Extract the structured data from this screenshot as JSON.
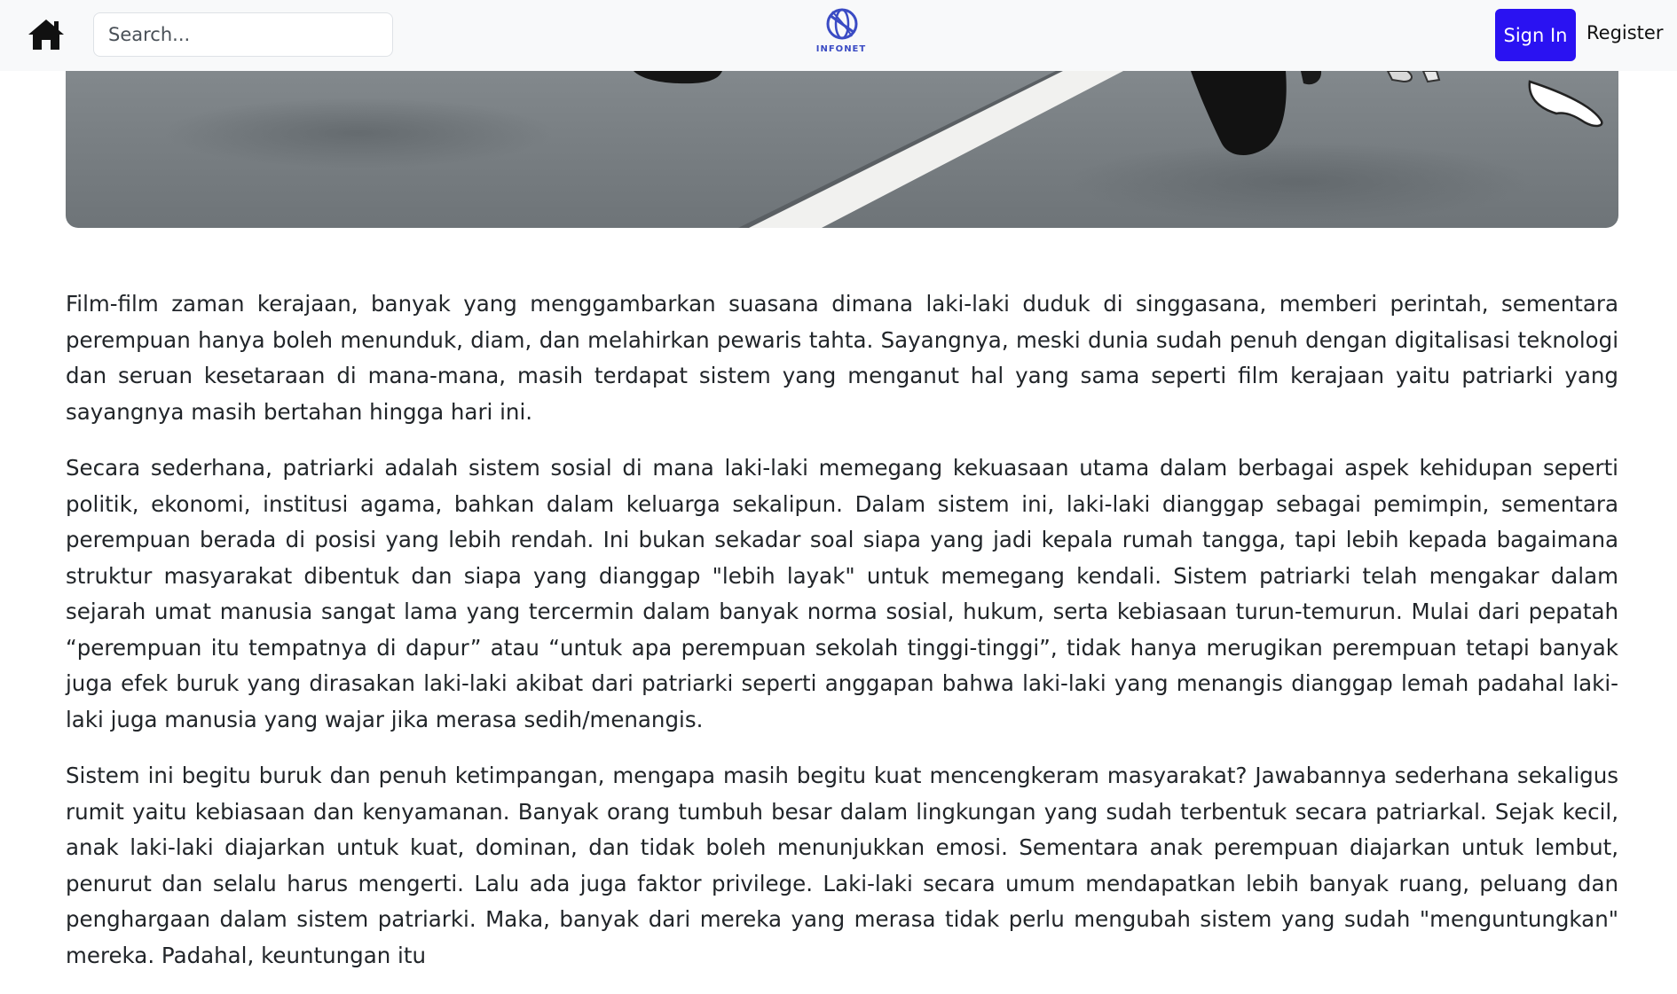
{
  "navbar": {
    "search": {
      "placeholder": "Search...",
      "value": ""
    },
    "logo_text": "INFONET",
    "signin_label": "Sign In",
    "register_label": "Register",
    "colors": {
      "background": "#f8f9fa",
      "signin_button": "#2a12f2",
      "logo": "#3a4bc4"
    },
    "icons": [
      "home-icon",
      "globe-logo-icon"
    ]
  },
  "hero": {
    "description": "cropped illustration: grey road with white lane stripe, dark-robed figures"
  },
  "article": {
    "paragraphs": [
      "Film-film zaman kerajaan, banyak yang menggambarkan suasana dimana laki-laki duduk di singgasana, memberi perintah, sementara perempuan hanya boleh menunduk, diam, dan melahirkan pewaris tahta. Sayangnya, meski dunia sudah penuh dengan digitalisasi teknologi dan seruan kesetaraan di mana-mana, masih terdapat sistem yang menganut hal yang sama seperti film kerajaan yaitu patriarki yang sayangnya masih bertahan hingga hari ini.",
      "Secara sederhana, patriarki adalah sistem sosial di mana laki-laki memegang kekuasaan utama dalam berbagai aspek kehidupan seperti politik, ekonomi, institusi agama, bahkan dalam keluarga sekalipun. Dalam sistem ini, laki-laki dianggap sebagai pemimpin, sementara perempuan berada di posisi yang lebih rendah. Ini bukan sekadar soal siapa yang jadi kepala rumah tangga, tapi lebih kepada bagaimana struktur masyarakat dibentuk dan siapa yang dianggap \"lebih layak\" untuk memegang kendali. Sistem patriarki telah mengakar dalam sejarah umat manusia sangat lama yang tercermin dalam banyak norma sosial, hukum, serta kebiasaan turun-temurun. Mulai dari pepatah “perempuan itu tempatnya di dapur” atau “untuk apa perempuan sekolah tinggi-tinggi”, tidak hanya merugikan perempuan tetapi banyak juga efek buruk yang dirasakan laki-laki akibat dari patriarki seperti anggapan bahwa laki-laki yang menangis dianggap lemah padahal laki-laki juga manusia yang wajar jika merasa sedih/menangis.",
      "Sistem ini begitu buruk dan penuh ketimpangan, mengapa masih begitu kuat mencengkeram masyarakat? Jawabannya sederhana sekaligus rumit yaitu kebiasaan dan kenyamanan. Banyak orang tumbuh besar dalam lingkungan yang sudah terbentuk secara patriarkal. Sejak kecil, anak laki-laki diajarkan untuk kuat, dominan, dan tidak boleh menunjukkan emosi. Sementara anak perempuan diajarkan untuk lembut, penurut dan selalu harus mengerti. Lalu ada juga faktor privilege. Laki-laki secara umum  mendapatkan lebih banyak ruang, peluang dan penghargaan dalam sistem patriarki. Maka, banyak dari mereka yang merasa tidak perlu mengubah sistem yang sudah \"menguntungkan\" mereka. Padahal, keuntungan itu"
    ]
  }
}
